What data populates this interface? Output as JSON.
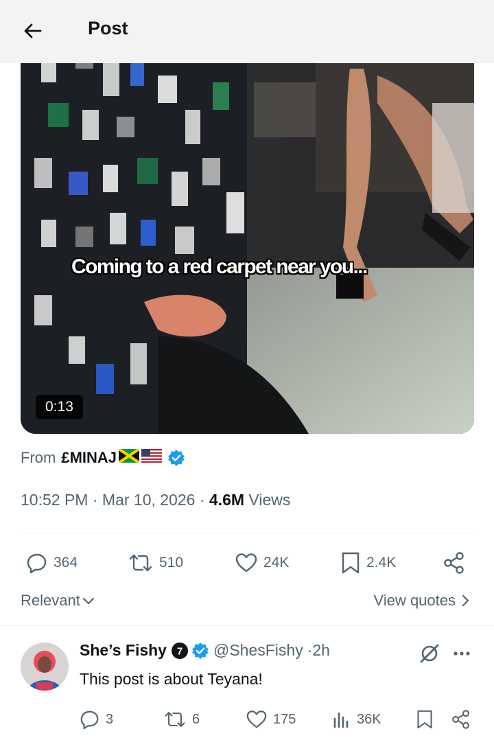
{
  "header": {
    "title": "Post"
  },
  "media": {
    "caption": "Coming to a red carpet near you...",
    "duration": "0:13"
  },
  "from": {
    "prefix": "From",
    "name": "£MINAJ",
    "verified": true
  },
  "meta": {
    "time": "10:52 PM",
    "date": "Mar 10, 2026",
    "views_count": "4.6M",
    "views_label": "Views"
  },
  "actions": {
    "replies": "364",
    "reposts": "510",
    "likes": "24K",
    "bookmarks": "2.4K"
  },
  "sort": {
    "label": "Relevant"
  },
  "quotes": {
    "label": "View quotes"
  },
  "reply": {
    "name": "She’s Fishy",
    "badge": "7",
    "handle": "@ShesFishy",
    "time": "2h",
    "text": "This post is about Teyana!",
    "replies": "3",
    "reposts": "6",
    "likes": "175",
    "views": "36K"
  },
  "colors": {
    "verified": "#1d9bf0",
    "muted": "#536471",
    "text": "#0f1419"
  }
}
